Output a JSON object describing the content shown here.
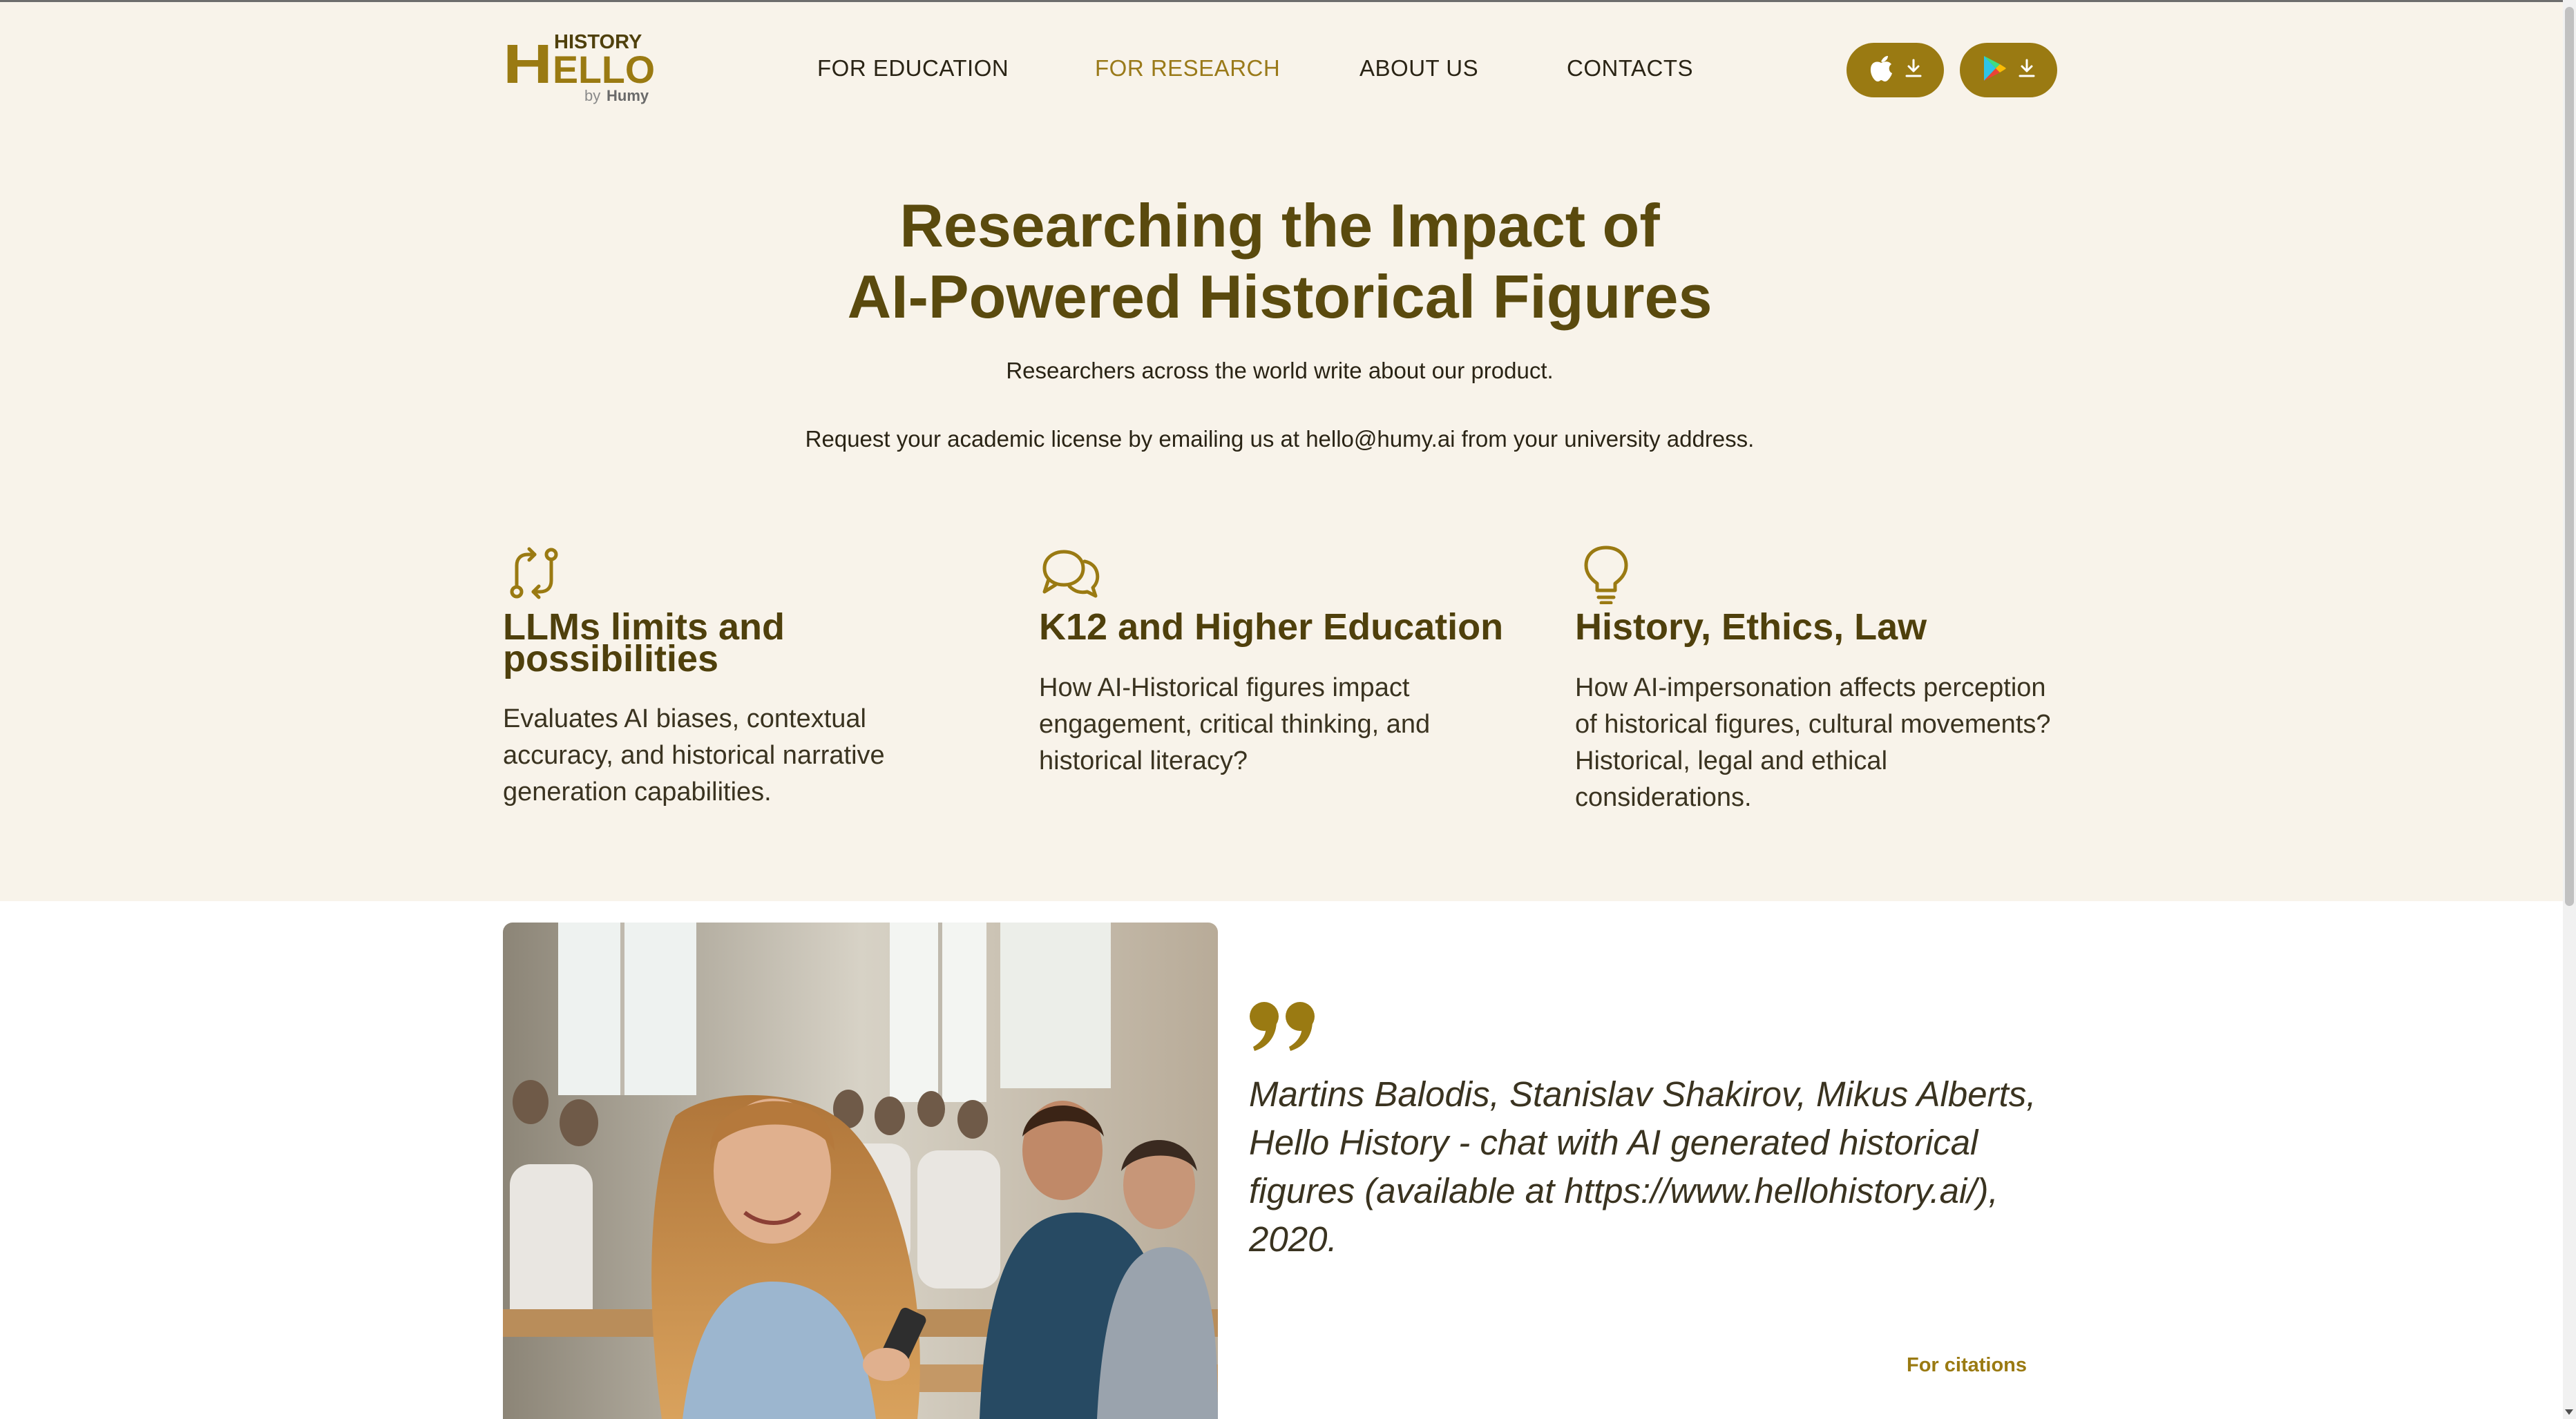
{
  "brand": {
    "logo_top": "HISTORY",
    "logo_main": "HELLO",
    "logo_by": "by",
    "logo_company": "Humy",
    "accent": "#9a7a12",
    "title_color": "#5a4a0e",
    "hero_bg": "#f8f3ea"
  },
  "nav": {
    "items": [
      {
        "label": "FOR EDUCATION",
        "active": false
      },
      {
        "label": "FOR RESEARCH",
        "active": true
      },
      {
        "label": "ABOUT US",
        "active": false
      },
      {
        "label": "CONTACTS",
        "active": false
      }
    ],
    "store_buttons": [
      {
        "icon": "apple-icon",
        "action_icon": "download-icon"
      },
      {
        "icon": "google-play-icon",
        "action_icon": "download-icon"
      }
    ]
  },
  "hero": {
    "title_line1": "Researching the Impact of",
    "title_line2": "AI-Powered Historical Figures",
    "subtitle": "Researchers across the world write about our product.",
    "license_note": "Request your academic license by emailing us at hello@humy.ai from your university address."
  },
  "features": [
    {
      "icon": "arrows-exchange-icon",
      "title": "LLMs limits and possibilities",
      "text": "Evaluates AI biases, contextual accuracy, and historical narrative generation capabilities."
    },
    {
      "icon": "chat-bubbles-icon",
      "title": "K12 and Higher Education",
      "text": "How AI-Historical figures impact engagement, critical thinking, and historical literacy?"
    },
    {
      "icon": "lightbulb-icon",
      "title": "History, Ethics, Law",
      "text": "How AI-impersonation affects perception of historical figures, cultural movements? Historical, legal and ethical considerations."
    }
  ],
  "citation": {
    "quote_icon": "quote-icon",
    "text": "Martins Balodis, Stanislav Shakirov, Mikus Alberts, Hello History - chat with AI generated historical figures (available at https://www.hellohistory.ai/), 2020.",
    "link_label": "For citations",
    "image": "students-classroom-photo"
  }
}
